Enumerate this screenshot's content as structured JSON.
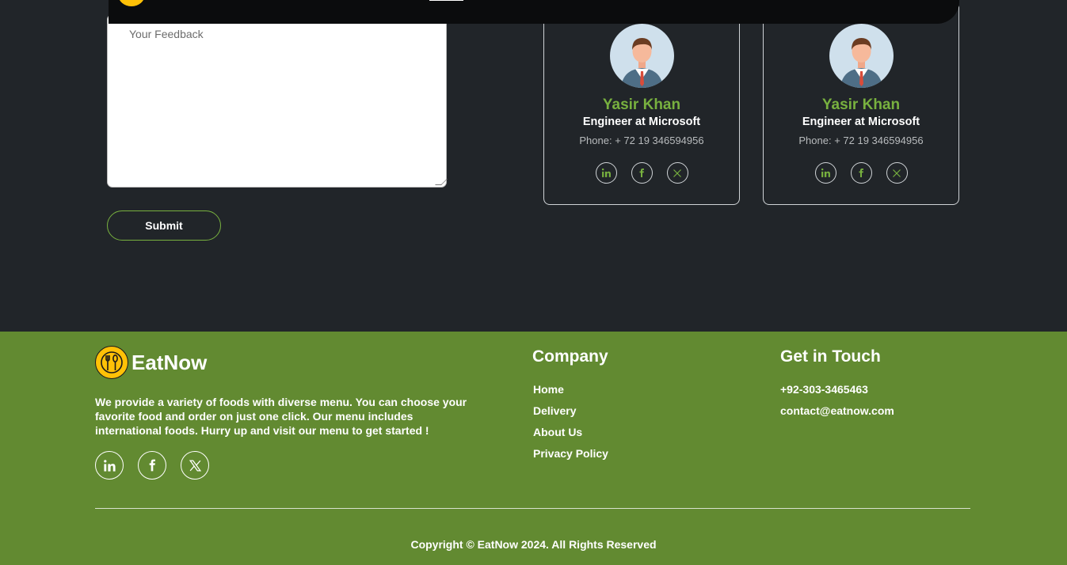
{
  "feedback": {
    "placeholder": "Your Feedback",
    "submit_label": "Submit"
  },
  "team_cards": [
    {
      "name": "Yasir Khan",
      "role": "Engineer at Microsoft",
      "phone": "Phone: + 72 19 346594956",
      "socials": [
        "linkedin-icon",
        "facebook-icon",
        "x-icon"
      ]
    },
    {
      "name": "Yasir Khan",
      "role": "Engineer at Microsoft",
      "phone": "Phone: + 72 19 346594956",
      "socials": [
        "linkedin-icon",
        "facebook-icon",
        "x-icon"
      ]
    }
  ],
  "footer": {
    "brand": "EatNow",
    "about": "We provide a variety of foods with diverse menu. You can choose your favorite food and order on just one click. Our menu includes international foods. Hurry up and visit our menu to get started !",
    "company_title": "Company",
    "company_links": [
      "Home",
      "Delivery",
      "About Us",
      "Privacy Policy"
    ],
    "touch_title": "Get in Touch",
    "phone": "+92-303-3465463",
    "email": "contact@eatnow.com",
    "copyright": "Copyright © EatNow 2024. All Rights Reserved"
  },
  "colors": {
    "accent_green": "#78b13f",
    "footer_bg": "#628a31",
    "page_bg": "#212529",
    "logo_yellow": "#ffc107"
  }
}
